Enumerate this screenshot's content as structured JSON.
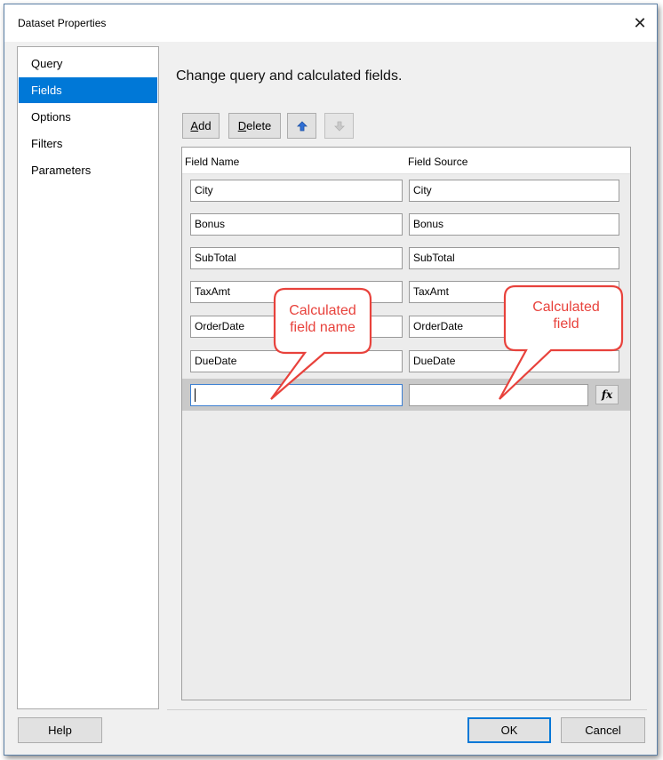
{
  "window": {
    "title": "Dataset Properties",
    "close_glyph": "✕"
  },
  "sidebar": {
    "items": [
      {
        "label": "Query",
        "selected": false
      },
      {
        "label": "Fields",
        "selected": true
      },
      {
        "label": "Options",
        "selected": false
      },
      {
        "label": "Filters",
        "selected": false
      },
      {
        "label": "Parameters",
        "selected": false
      }
    ]
  },
  "main": {
    "heading": "Change query and calculated fields.",
    "toolbar": {
      "add_label": "Add",
      "add_access": "A",
      "add_rest": "dd",
      "delete_label": "Delete",
      "delete_access": "D",
      "delete_rest": "elete",
      "move_up_icon": "arrow-up-icon",
      "move_down_icon": "arrow-down-icon"
    },
    "grid": {
      "columns": [
        "Field Name",
        "Field Source"
      ],
      "rows": [
        {
          "name": "City",
          "source": "City"
        },
        {
          "name": "Bonus",
          "source": "Bonus"
        },
        {
          "name": "SubTotal",
          "source": "SubTotal"
        },
        {
          "name": "TaxAmt",
          "source": "TaxAmt"
        },
        {
          "name": "OrderDate",
          "source": "OrderDate"
        },
        {
          "name": "DueDate",
          "source": "DueDate"
        }
      ],
      "new_row": {
        "name": "",
        "source": "",
        "expression_button": "fx"
      }
    },
    "callouts": [
      {
        "text_line1": "Calculated",
        "text_line2": "field name"
      },
      {
        "text_line1": "Calculated",
        "text_line2": "field"
      }
    ]
  },
  "footer": {
    "help": "Help",
    "ok": "OK",
    "cancel": "Cancel"
  },
  "colors": {
    "accent": "#0078d7",
    "callout_text": "#e8423c",
    "callout_border": "#e8423c"
  }
}
